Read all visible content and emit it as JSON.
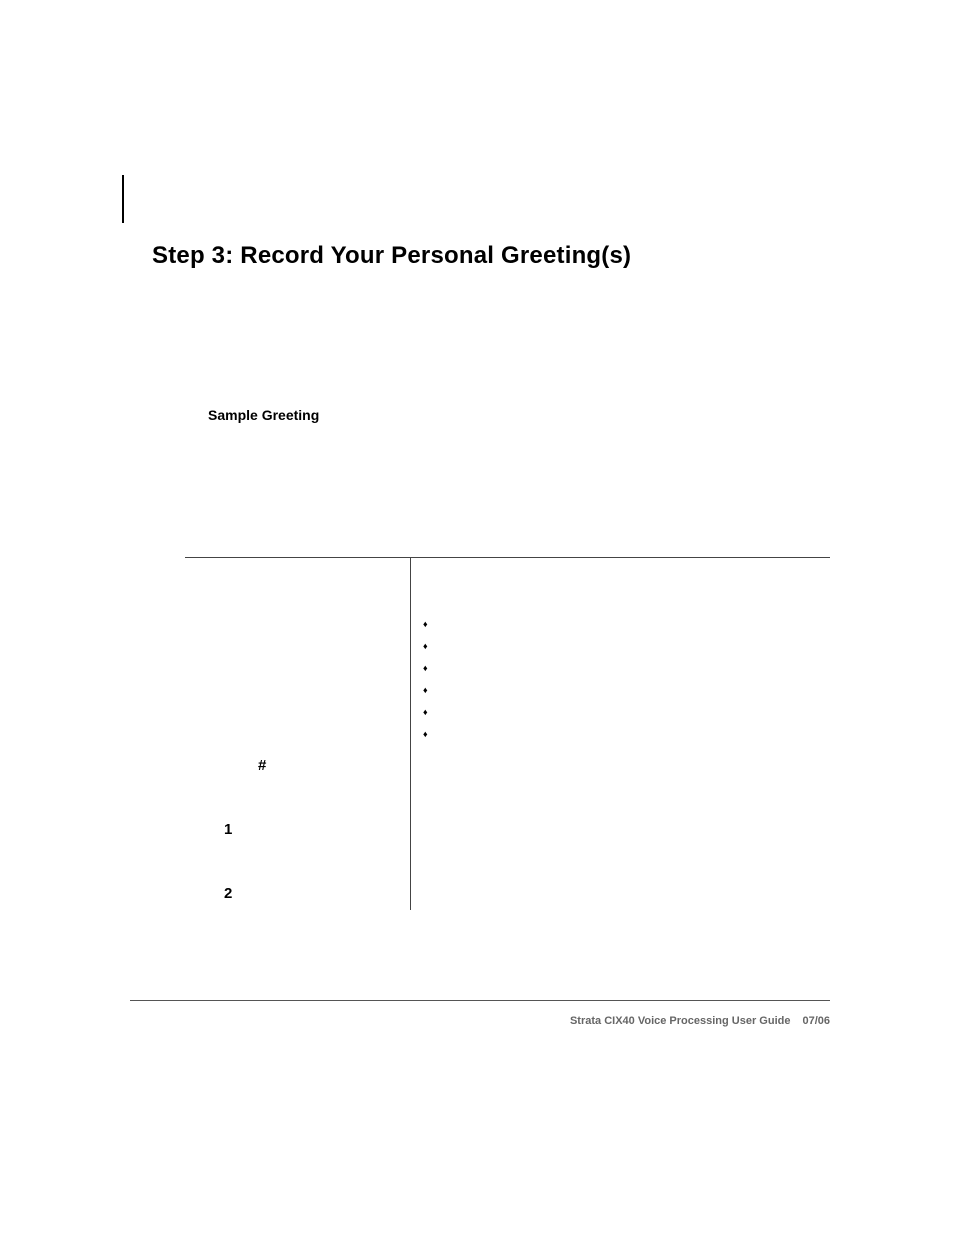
{
  "heading": "Step 3:  Record Your Personal Greeting(s)",
  "subheading": "Sample Greeting",
  "keys": {
    "hash": "#",
    "one": "1",
    "two": "2"
  },
  "bullets": [
    "",
    "",
    "",
    "",
    "",
    ""
  ],
  "footer": {
    "title": "Strata CIX40 Voice Processing User Guide",
    "date": "07/06"
  }
}
